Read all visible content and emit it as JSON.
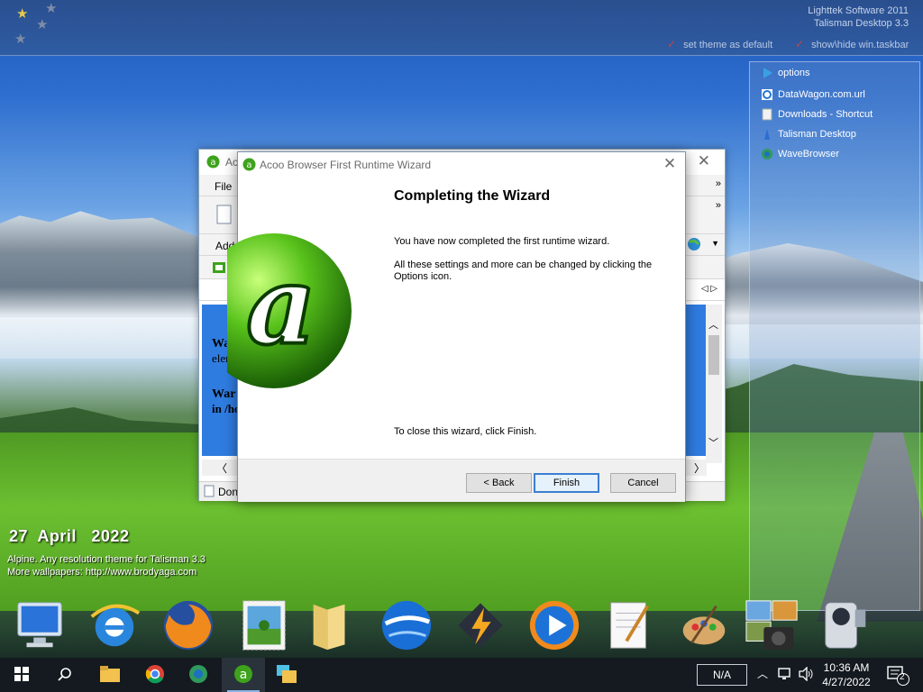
{
  "top_bar": {
    "credit_line1": "Lighttek Software 2011",
    "credit_line2": "Talisman Desktop 3.3",
    "link_theme": "set theme as default",
    "link_taskbar": "show\\hide win.taskbar"
  },
  "side_panel": {
    "items": [
      {
        "label": "options",
        "icon": "play-icon"
      },
      {
        "label": "DataWagon.com.url",
        "icon": "ie-icon"
      },
      {
        "label": "Downloads - Shortcut",
        "icon": "file-icon"
      },
      {
        "label": "Talisman Desktop",
        "icon": "talisman-icon"
      },
      {
        "label": "WaveBrowser",
        "icon": "wavebrowser-icon"
      }
    ]
  },
  "desktop": {
    "date_day": "27",
    "date_month": "April",
    "date_year": "2022",
    "theme_line1": "Alpine. Any resolution theme for Talisman 3.3",
    "theme_line2": "More wallpapers: http://www.brodyaga.com"
  },
  "browser": {
    "title_partial": "Ac",
    "menu_file": "File",
    "address_partial": "Addr",
    "tab_partial": "ta",
    "pl_partial": "Pl",
    "content_line1_bold": "War",
    "content_line1": "elem",
    "content_line2_bold": "War",
    "content_line2": "in /ho",
    "status_partial": "Don"
  },
  "wizard": {
    "title": "Acoo Browser First Runtime Wizard",
    "heading": "Completing the Wizard",
    "para1": "You have now completed the first runtime wizard.",
    "para2": "All these settings and more can be changed by clicking the Options icon.",
    "para3": "To close this wizard, click Finish.",
    "back_label": "< Back",
    "finish_label": "Finish",
    "cancel_label": "Cancel",
    "logo_letter": "a"
  },
  "taskbar": {
    "na_label": "N/A",
    "time": "10:36 AM",
    "date": "4/27/2022",
    "notification_count": "2"
  },
  "colors": {
    "accent": "#3c7fd1",
    "acoo_green": "#3ea21c",
    "taskbar_bg": "#141a20"
  }
}
